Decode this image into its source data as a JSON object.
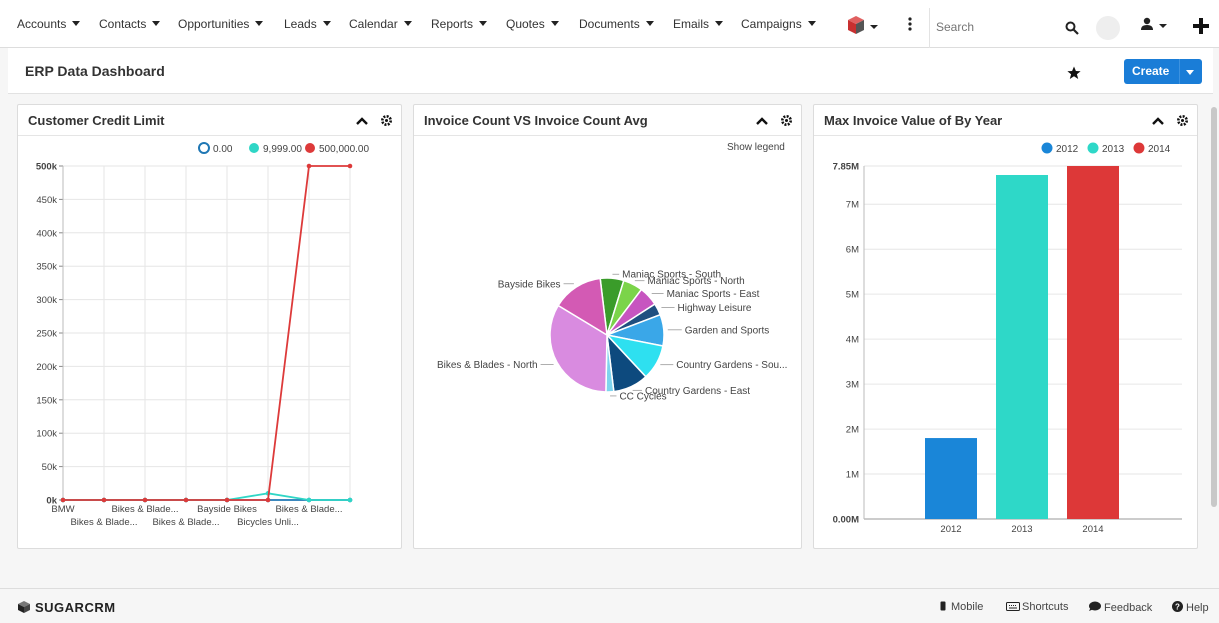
{
  "nav": {
    "items": [
      {
        "label": "Accounts"
      },
      {
        "label": "Contacts"
      },
      {
        "label": "Opportunities"
      },
      {
        "label": "Leads"
      },
      {
        "label": "Calendar"
      },
      {
        "label": "Reports"
      },
      {
        "label": "Quotes"
      },
      {
        "label": "Documents"
      },
      {
        "label": "Emails"
      },
      {
        "label": "Campaigns"
      }
    ],
    "search_placeholder": "Search"
  },
  "header": {
    "title": "ERP Data Dashboard",
    "create_label": "Create"
  },
  "dashlets": {
    "credit": {
      "title": "Customer Credit Limit",
      "legend": [
        "0.00",
        "9,999.00",
        "500,000.00"
      ],
      "y_ticks": [
        "500k",
        "450k",
        "400k",
        "350k",
        "300k",
        "250k",
        "200k",
        "150k",
        "100k",
        "50k",
        "0k"
      ],
      "x_labels_top": [
        "BMW",
        "Bikes & Blade...",
        "Bayside Bikes",
        "Bikes & Blade..."
      ],
      "x_labels_bottom": [
        "Bikes & Blade...",
        "Bikes & Blade...",
        "Bicycles Unli..."
      ]
    },
    "invoice_count": {
      "title": "Invoice Count VS Invoice Count Avg",
      "show_legend": "Show legend",
      "pie_labels": [
        "Maniac Sports - South",
        "Maniac Sports - North",
        "Maniac Sports - East",
        "Highway Leisure",
        "Garden and Sports",
        "Country Gardens - Sou...",
        "Country Gardens - East",
        "CC Cycles",
        "Bikes & Blades - North",
        "Bayside Bikes"
      ]
    },
    "max_invoice": {
      "title": "Max Invoice Value of By Year",
      "legend": [
        "2012",
        "2013",
        "2014"
      ],
      "y_ticks": [
        "7.85M",
        "7M",
        "6M",
        "5M",
        "4M",
        "3M",
        "2M",
        "1M",
        "0.00M"
      ],
      "x_labels": [
        "2012",
        "2013",
        "2014"
      ]
    }
  },
  "footer": {
    "brand": "SUGARCRM",
    "links": [
      "Mobile",
      "Shortcuts",
      "Feedback",
      "Help"
    ]
  },
  "colors": {
    "accent": "#1a7dd7",
    "s0": "#1f77b4",
    "s1": "#2fd6c6",
    "s2": "#dd3a3a"
  },
  "chart_data": [
    {
      "type": "line",
      "title": "Customer Credit Limit",
      "categories": [
        "BMW",
        "Bikes & Blade...",
        "Bikes & Blade...",
        "Bikes & Blade...",
        "Bikes & Blade...",
        "Bayside Bikes",
        "Bicycles Unli...",
        "Bikes & Blade..."
      ],
      "ylim": [
        0,
        500000
      ],
      "series": [
        {
          "name": "0.00",
          "color": "#1f77b4",
          "values": [
            0,
            0,
            0,
            0,
            0,
            0,
            0,
            0
          ]
        },
        {
          "name": "9,999.00",
          "color": "#2fd6c6",
          "values": [
            0,
            0,
            0,
            0,
            0,
            9999,
            0,
            0
          ]
        },
        {
          "name": "500,000.00",
          "color": "#dd3a3a",
          "values": [
            0,
            0,
            0,
            0,
            0,
            0,
            500000,
            500000
          ]
        }
      ],
      "grid": true,
      "legend": "top-right"
    },
    {
      "type": "pie",
      "title": "Invoice Count VS Invoice Count Avg",
      "slices": [
        {
          "label": "Maniac Sports - South",
          "value": 6,
          "color": "#3a9c2a"
        },
        {
          "label": "Maniac Sports - North",
          "value": 5,
          "color": "#7bd44a"
        },
        {
          "label": "Maniac Sports - East",
          "value": 5,
          "color": "#c755c0"
        },
        {
          "label": "Highway Leisure",
          "value": 3,
          "color": "#1f4f80"
        },
        {
          "label": "Garden and Sports",
          "value": 8,
          "color": "#3aa7e8"
        },
        {
          "label": "Country Gardens - Sou...",
          "value": 9,
          "color": "#2ee0f0"
        },
        {
          "label": "Country Gardens - East",
          "value": 9,
          "color": "#0d4a7e"
        },
        {
          "label": "CC Cycles",
          "value": 2,
          "color": "#7ed4ee"
        },
        {
          "label": "Bikes & Blades - North",
          "value": 30,
          "color": "#d98be0"
        },
        {
          "label": "Bayside Bikes",
          "value": 13,
          "color": "#d35ab4"
        }
      ]
    },
    {
      "type": "bar",
      "title": "Max Invoice Value of By Year",
      "categories": [
        "2012",
        "2013",
        "2014"
      ],
      "values": [
        1800000,
        7650000,
        7850000
      ],
      "colors": [
        "#1a86d8",
        "#2ed8c8",
        "#dd3838"
      ],
      "ylim": [
        0,
        7850000
      ],
      "grid": true,
      "legend": "top-right"
    }
  ]
}
